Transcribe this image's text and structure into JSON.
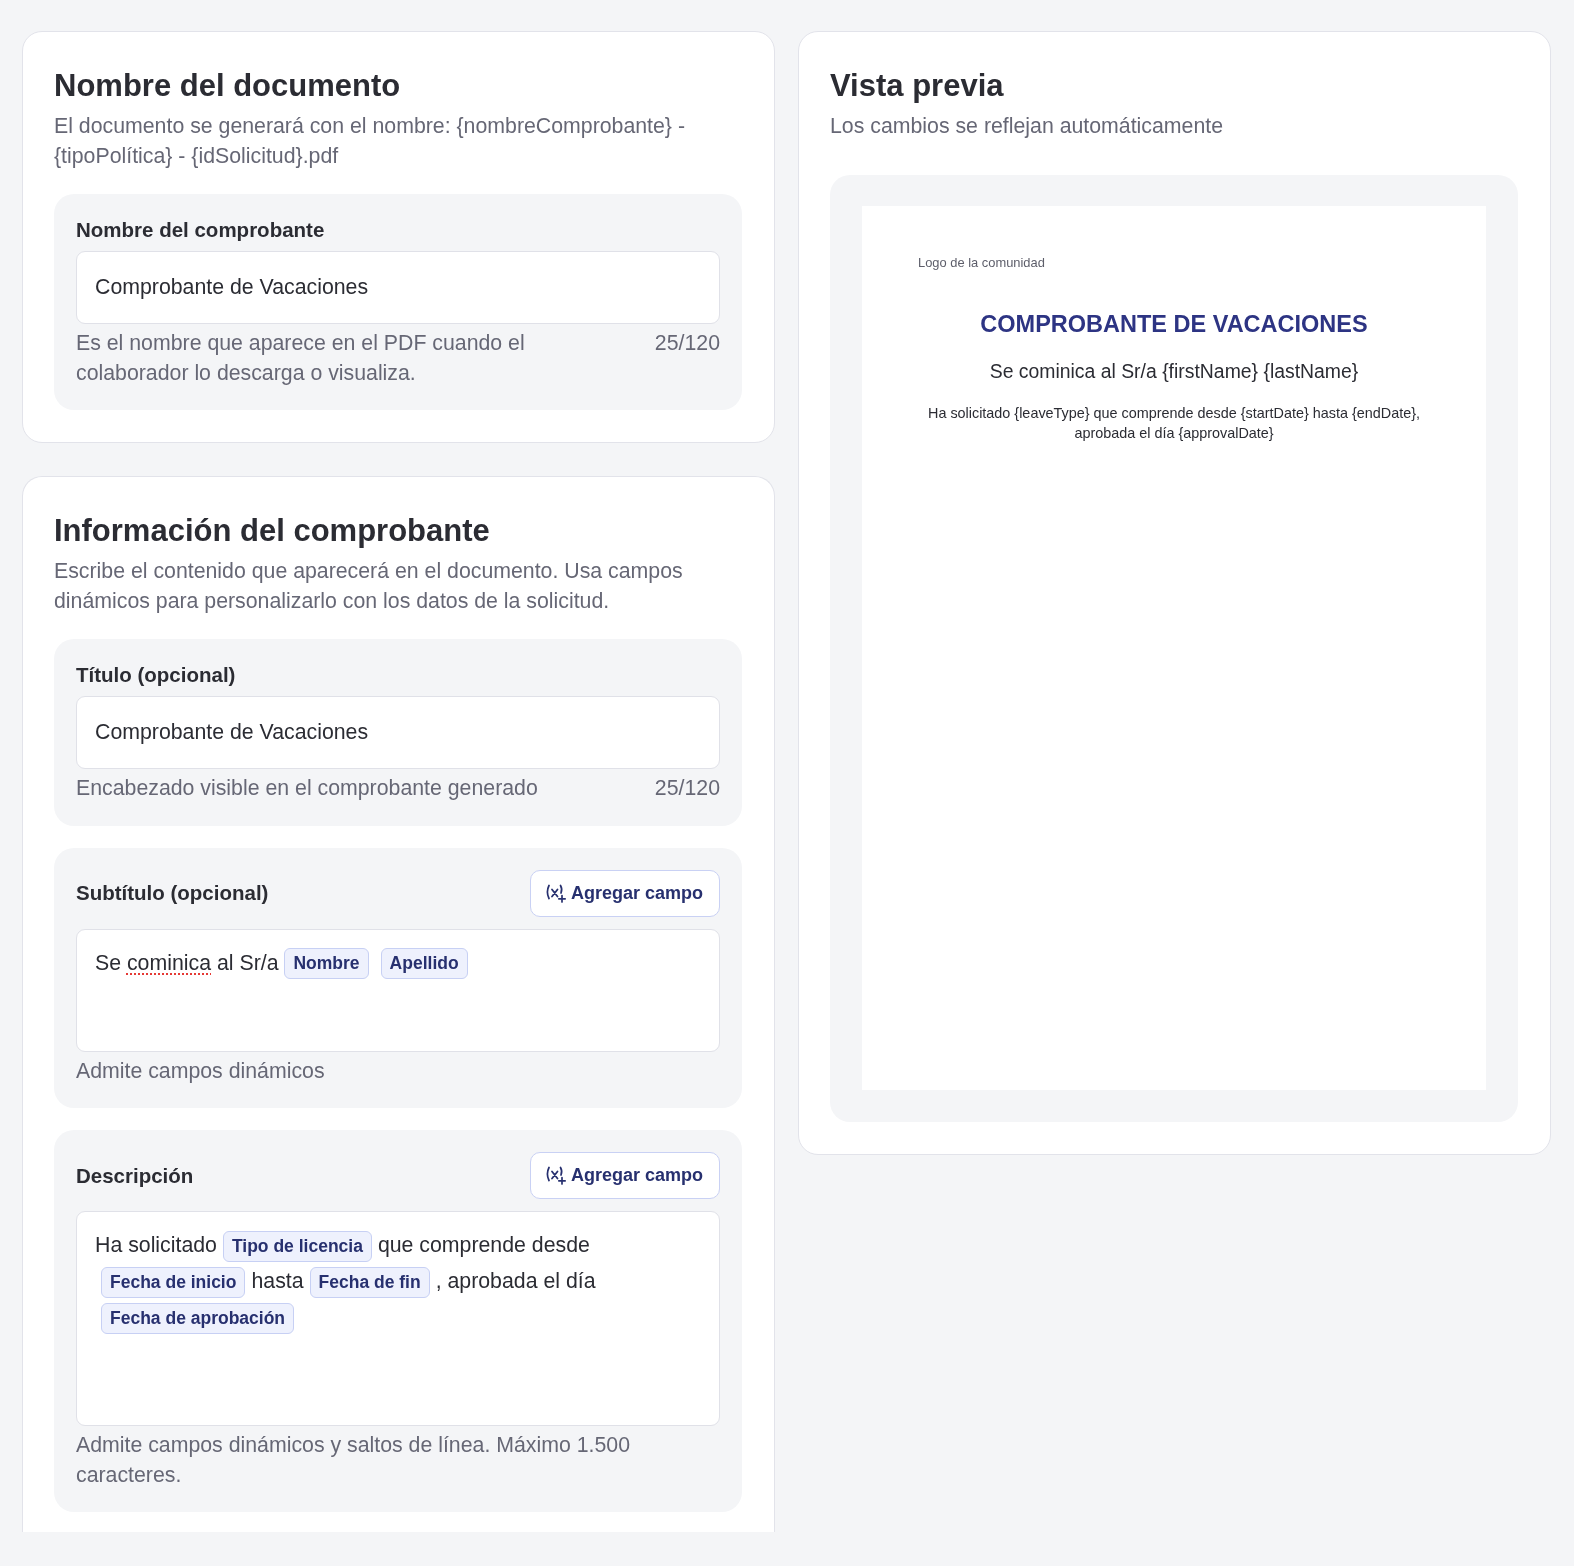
{
  "document_name": {
    "title": "Nombre del documento",
    "description": "El documento se generará con el nombre: {nombreComprobante} - {tipoPolítica} - {idSolicitud}.pdf",
    "field": {
      "label": "Nombre del comprobante",
      "value": "Comprobante de Vacaciones",
      "helper": "Es el nombre que aparece en el PDF cuando el colaborador lo descarga o visualiza.",
      "counter": "25/120"
    }
  },
  "receipt_info": {
    "title": "Información del comprobante",
    "description": "Escribe el contenido que aparecerá en el documento. Usa campos dinámicos para personalizarlo con los datos de la solicitud.",
    "fields": [
      {
        "kind": "input",
        "label": "Título (opcional)",
        "value": "Comprobante de Vacaciones",
        "helper": "Encabezado visible en el comprobante generado",
        "counter": "25/120"
      },
      {
        "kind": "rich",
        "label": "Subtítulo (opcional)",
        "button": "Agregar campo",
        "content": [
          {
            "kind": "text",
            "parts": [
              {
                "text": "Se ",
                "misspelled": false
              },
              {
                "text": "cominica",
                "misspelled": true
              },
              {
                "text": " al Sr/a",
                "misspelled": false
              }
            ]
          },
          {
            "kind": "chip",
            "text": "Nombre"
          },
          {
            "kind": "chip",
            "text": "Apellido"
          }
        ],
        "helper": "Admite campos dinámicos"
      },
      {
        "kind": "rich",
        "label": "Descripción",
        "button": "Agregar campo",
        "content": [
          {
            "kind": "text",
            "parts": [
              {
                "text": "Ha solicitado",
                "misspelled": false
              }
            ]
          },
          {
            "kind": "chip",
            "text": "Tipo de licencia"
          },
          {
            "kind": "text",
            "parts": [
              {
                "text": "que comprende desde",
                "misspelled": false
              }
            ]
          },
          {
            "kind": "chip",
            "text": "Fecha de inicio"
          },
          {
            "kind": "text",
            "parts": [
              {
                "text": "hasta",
                "misspelled": false
              }
            ]
          },
          {
            "kind": "chip",
            "text": "Fecha de fin"
          },
          {
            "kind": "text",
            "parts": [
              {
                "text": ", aprobada el día",
                "misspelled": false
              }
            ]
          },
          {
            "kind": "chip",
            "text": "Fecha de aprobación"
          }
        ],
        "helper": "Admite campos dinámicos y saltos de línea. Máximo 1.500 caracteres."
      }
    ]
  },
  "preview": {
    "title": "Vista previa",
    "subtitle": "Los cambios se reflejan automáticamente",
    "document": {
      "logo": "Logo de la comunidad",
      "heading": "COMPROBANTE DE VACACIONES",
      "subtitle": "Se cominica al Sr/a {firstName} {lastName}",
      "body": "Ha solicitado {leaveType} que comprende desde {startDate} hasta {endDate}, aprobada el día {approvalDate}"
    }
  }
}
